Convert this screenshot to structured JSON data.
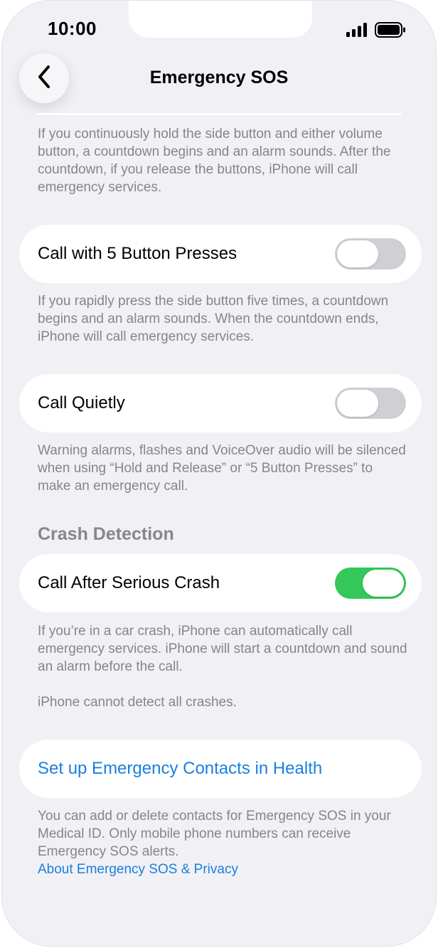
{
  "status_bar": {
    "time": "10:00",
    "icons": [
      "cellular-signal-icon",
      "battery-icon"
    ]
  },
  "nav": {
    "back_icon": "chevron-left-icon",
    "title": "Emergency SOS"
  },
  "top_footnote": "If you continuously hold the side button and either volume button, a countdown begins and an alarm sounds. After the countdown, if you release the buttons, iPhone will call emergency services.",
  "settings": [
    {
      "label": "Call with 5 Button Presses",
      "enabled": false,
      "footnote": "If you rapidly press the side button five times, a countdown begins and an alarm sounds. When the countdown ends, iPhone will call emergency services."
    },
    {
      "label": "Call Quietly",
      "enabled": false,
      "footnote": "Warning alarms, flashes and VoiceOver audio will be silenced when using “Hold and Release” or “5 Button Presses” to make an emergency call."
    }
  ],
  "crash_detection": {
    "header": "Crash Detection",
    "label": "Call After Serious Crash",
    "enabled": true,
    "footnote_1": "If you’re in a car crash, iPhone can automatically call emergency services. iPhone will start a countdown and sound an alarm before the call.",
    "footnote_2": "iPhone cannot detect all crashes."
  },
  "emergency_contacts": {
    "link_label": "Set up Emergency Contacts in Health",
    "footnote": "You can add or delete contacts for Emergency SOS in your Medical ID. Only mobile phone numbers can receive Emergency SOS alerts.",
    "privacy_link": "About Emergency SOS & Privacy"
  },
  "colors": {
    "background": "#f1f0f5",
    "toggle_on": "#34c759",
    "toggle_off": "#d0d0d4",
    "link": "#1a7fe0",
    "secondary_text": "#85858a"
  }
}
